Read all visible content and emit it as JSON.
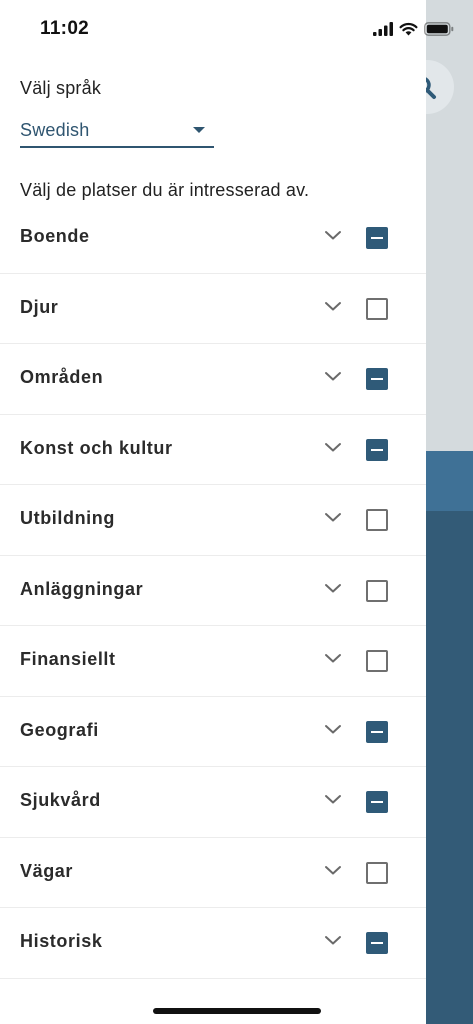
{
  "status_bar": {
    "time": "11:02"
  },
  "language": {
    "label": "Välj språk",
    "selected": "Swedish"
  },
  "places": {
    "label": "Välj de platser du är intresserad av."
  },
  "categories": [
    {
      "label": "Boende",
      "state": "partial"
    },
    {
      "label": "Djur",
      "state": "unchecked"
    },
    {
      "label": "Områden",
      "state": "partial"
    },
    {
      "label": "Konst och kultur",
      "state": "partial"
    },
    {
      "label": "Utbildning",
      "state": "unchecked"
    },
    {
      "label": "Anläggningar",
      "state": "unchecked"
    },
    {
      "label": "Finansiellt",
      "state": "unchecked"
    },
    {
      "label": "Geografi",
      "state": "partial"
    },
    {
      "label": "Sjukvård",
      "state": "partial"
    },
    {
      "label": "Vägar",
      "state": "unchecked"
    },
    {
      "label": "Historisk",
      "state": "partial"
    }
  ],
  "colors": {
    "accent": "#2f5a78",
    "background_panel": "#335b77",
    "background_band": "#3f7196"
  }
}
